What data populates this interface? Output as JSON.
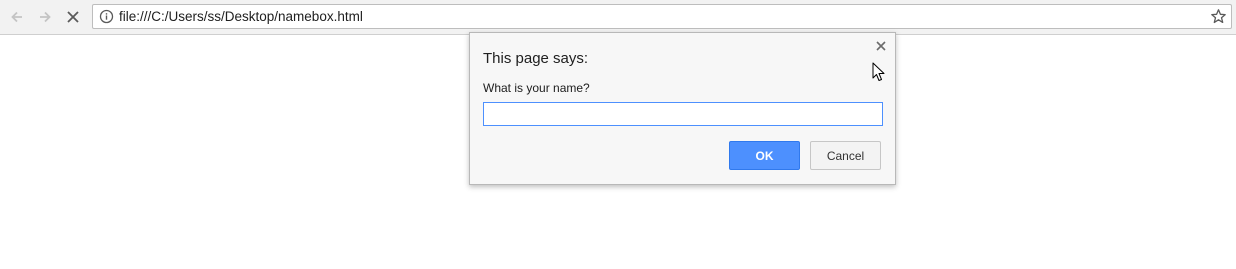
{
  "browser": {
    "url": "file:///C:/Users/ss/Desktop/namebox.html",
    "back_icon": "back-arrow-icon",
    "forward_icon": "forward-arrow-icon",
    "stop_icon": "stop-x-icon",
    "info_icon": "info-icon",
    "bookmark_icon": "star-icon"
  },
  "dialog": {
    "title": "This page says:",
    "message": "What is your name?",
    "input_value": "",
    "ok_label": "OK",
    "cancel_label": "Cancel",
    "close_icon": "close-icon",
    "accent_color": "#4d90fe"
  }
}
